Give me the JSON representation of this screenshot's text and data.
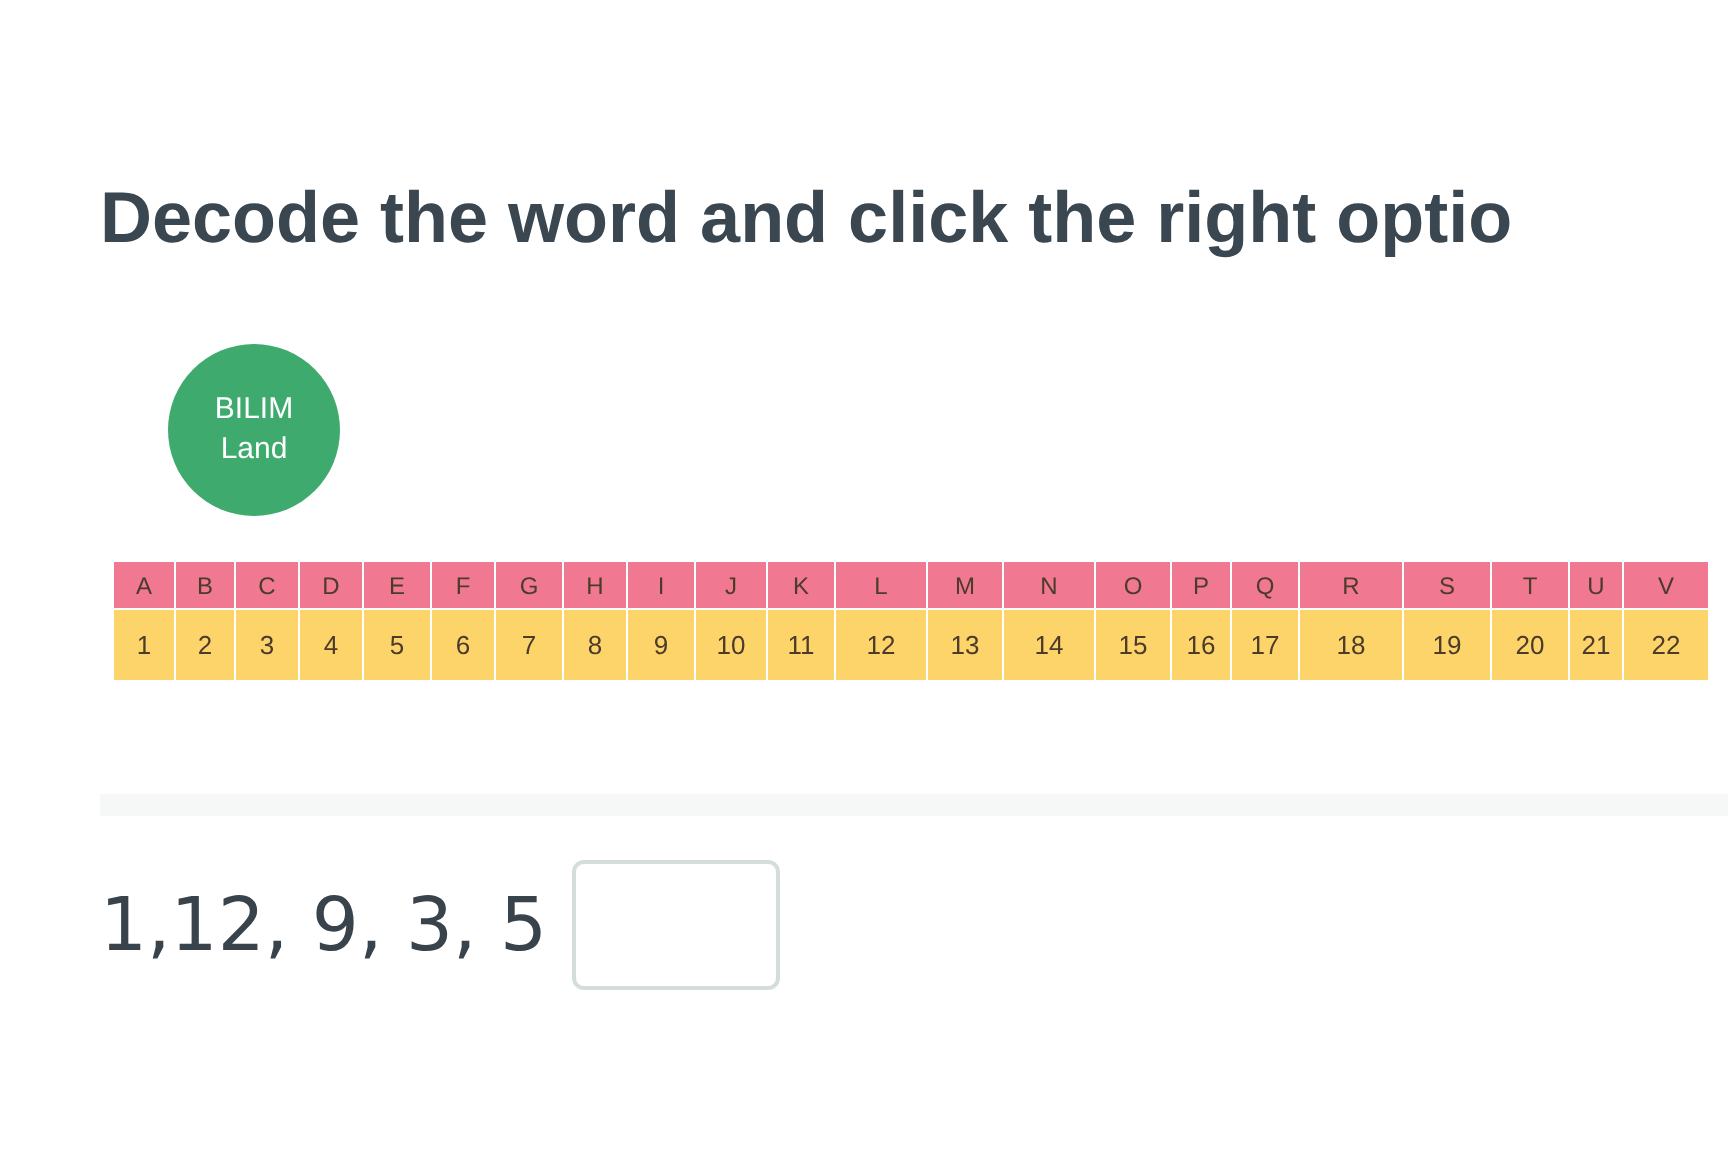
{
  "heading": "Decode the word and click the right optio",
  "logo": {
    "lines": [
      "BILIM",
      "Land"
    ]
  },
  "cipher_table": {
    "letters": [
      "A",
      "B",
      "C",
      "D",
      "E",
      "F",
      "G",
      "H",
      "I",
      "J",
      "K",
      "L",
      "M",
      "N",
      "O",
      "P",
      "Q",
      "R",
      "S",
      "T",
      "U",
      "V"
    ],
    "numbers": [
      "1",
      "2",
      "3",
      "4",
      "5",
      "6",
      "7",
      "8",
      "9",
      "10",
      "11",
      "12",
      "13",
      "14",
      "15",
      "16",
      "17",
      "18",
      "19",
      "20",
      "21",
      "22"
    ]
  },
  "question": {
    "code": "1,12, 9, 3, 5"
  }
}
